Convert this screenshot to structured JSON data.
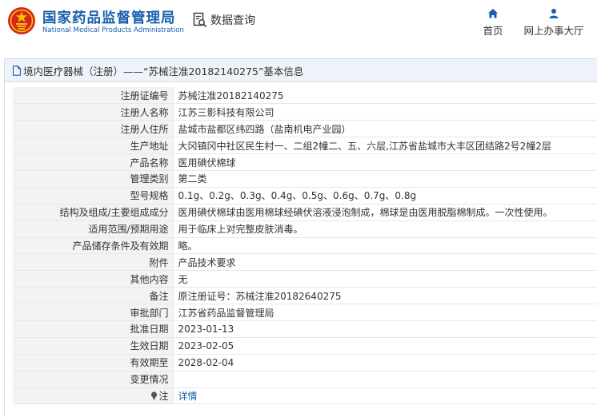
{
  "header": {
    "site_name_cn": "国家药品监督管理局",
    "site_name_en": "National Medical Products Administration",
    "section_title": "数据查询",
    "nav": [
      {
        "label": "首页",
        "icon": "home-icon"
      },
      {
        "label": "网上办事大厅",
        "icon": "user-icon"
      }
    ]
  },
  "panel": {
    "title": "境内医疗器械（注册）——“苏械注准20182140275”基本信息"
  },
  "fields": [
    {
      "label": "注册证编号",
      "value": "苏械注准20182140275"
    },
    {
      "label": "注册人名称",
      "value": "江苏三影科技有限公司"
    },
    {
      "label": "注册人住所",
      "value": "盐城市盐都区纬四路（盐南机电产业园）"
    },
    {
      "label": "生产地址",
      "value": "大冈镇冈中社区民生村一、二组2幢二、五、六层,江苏省盐城市大丰区团结路2号2幢2层"
    },
    {
      "label": "产品名称",
      "value": "医用碘伏棉球"
    },
    {
      "label": "管理类别",
      "value": "第二类"
    },
    {
      "label": "型号规格",
      "value": "0.1g、0.2g、0.3g、0.4g、0.5g、0.6g、0.7g、0.8g"
    },
    {
      "label": "结构及组成/主要组成成分",
      "value": "医用碘伏棉球由医用棉球经碘伏溶液浸泡制成，棉球是由医用脱脂棉制成。一次性使用。"
    },
    {
      "label": "适用范围/预期用途",
      "value": "用于临床上对完整皮肤消毒。"
    },
    {
      "label": "产品储存条件及有效期",
      "value": "略。"
    },
    {
      "label": "附件",
      "value": "产品技术要求"
    },
    {
      "label": "其他内容",
      "value": "无"
    },
    {
      "label": "备注",
      "value": "原注册证号：苏械注准20182640275"
    },
    {
      "label": "审批部门",
      "value": "江苏省药品监督管理局"
    },
    {
      "label": "批准日期",
      "value": "2023-01-13"
    },
    {
      "label": "生效日期",
      "value": "2023-02-05"
    },
    {
      "label": "有效期至",
      "value": "2028-02-04"
    },
    {
      "label": "变更情况",
      "value": ""
    }
  ],
  "note": {
    "label": "注",
    "link": "详情"
  },
  "colors": {
    "brand_blue": "#1a5fae",
    "emblem_red": "#d7261e",
    "emblem_gold": "#f2c500"
  }
}
